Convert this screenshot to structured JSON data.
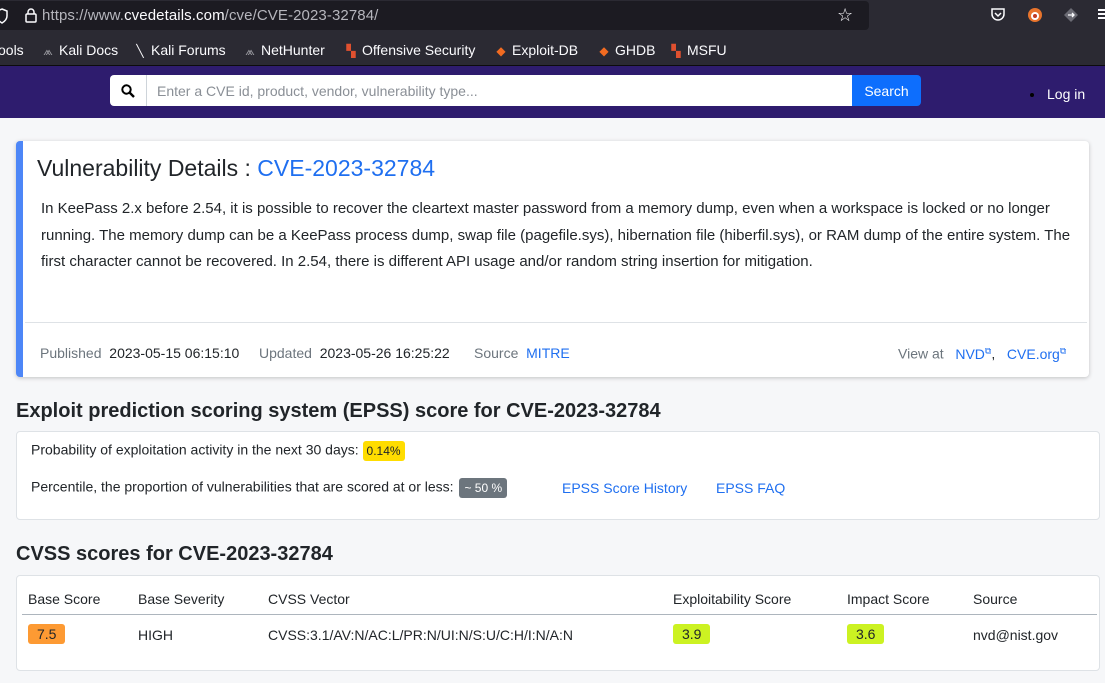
{
  "browser": {
    "url_prefix": "https://www.",
    "url_domain": "cvedetails.com",
    "url_path": "/cve/CVE-2023-32784/",
    "bookmarks": [
      {
        "label": "ools"
      },
      {
        "label": "Kali Docs"
      },
      {
        "label": "Kali Forums"
      },
      {
        "label": "NetHunter"
      },
      {
        "label": "Offensive Security"
      },
      {
        "label": "Exploit-DB"
      },
      {
        "label": "GHDB"
      },
      {
        "label": "MSFU"
      }
    ]
  },
  "header": {
    "search_placeholder": "Enter a CVE id, product, vendor, vulnerability type...",
    "search_button": "Search",
    "login": "Log in",
    "colors": {
      "bar": "#2e1c6e",
      "button": "#0d6efd"
    }
  },
  "vuln": {
    "title_prefix": "Vulnerability Details : ",
    "cve_id": "CVE-2023-32784",
    "description": "In KeePass 2.x before 2.54, it is possible to recover the cleartext master password from a memory dump, even when a workspace is locked or no longer running. The memory dump can be a KeePass process dump, swap file (pagefile.sys), hibernation file (hiberfil.sys), or RAM dump of the entire system. The first character cannot be recovered. In 2.54, there is different API usage and/or random string insertion for mitigation.",
    "published_label": "Published",
    "published": "2023-05-15 06:15:10",
    "updated_label": "Updated",
    "updated": "2023-05-26 16:25:22",
    "source_label": "Source",
    "source": "MITRE",
    "view_at_label": "View at",
    "nvd": "NVD",
    "separator": ",",
    "cve_org": "CVE.org"
  },
  "epss": {
    "heading": "Exploit prediction scoring system (EPSS) score for CVE-2023-32784",
    "probability_label": "Probability of exploitation activity in the next 30 days:",
    "probability": "0.14%",
    "percentile_label": "Percentile, the proportion of vulnerabilities that are scored at or less:",
    "percentile": "~ 50 %",
    "history_link": "EPSS Score History",
    "faq_link": "EPSS FAQ"
  },
  "cvss": {
    "heading": "CVSS scores for CVE-2023-32784",
    "columns": [
      "Base Score",
      "Base Severity",
      "CVSS Vector",
      "Exploitability Score",
      "Impact Score",
      "Source"
    ],
    "row": {
      "base_score": "7.5",
      "base_color": "#fd9a33",
      "severity": "HIGH",
      "vector": "CVSS:3.1/AV:N/AC:L/PR:N/UI:N/S:U/C:H/I:N/A:N",
      "exploitability": "3.9",
      "exploitability_color": "#ccf222",
      "impact": "3.6",
      "impact_color": "#ccf222",
      "source": "nvd@nist.gov"
    }
  }
}
